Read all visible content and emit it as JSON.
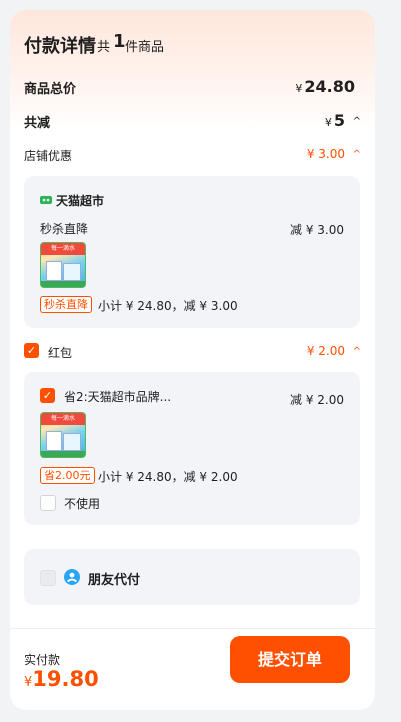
{
  "header": {
    "title": "付款详情",
    "sub_prefix": "共",
    "item_count": "1",
    "sub_suffix": "件商品"
  },
  "total_price": {
    "label": "商品总价",
    "currency": "¥",
    "amount": "24.80"
  },
  "total_reduce": {
    "label": "共减",
    "currency": "¥",
    "amount": "5"
  },
  "store_discount": {
    "label": "店铺优惠",
    "amount_text": "¥ 3.00",
    "card": {
      "store_name": "天猫超市",
      "promo_name": "秒杀直降",
      "promo_reduce": "减 ¥ 3.00",
      "thumb_text": "每一滴水",
      "tag": "秒杀直降",
      "subtotal_text": "小计 ¥ 24.80，减 ¥ 3.00"
    }
  },
  "red_packet": {
    "label": "红包",
    "amount_text": "¥ 2.00",
    "card": {
      "coupon_name": "省2:天猫超市品牌...",
      "coupon_reduce": "减 ¥ 2.00",
      "thumb_text": "每一滴水",
      "tag": "省2.00元",
      "subtotal_text": "小计 ¥ 24.80，减 ¥ 2.00",
      "no_use_label": "不使用"
    }
  },
  "friend_pay": {
    "label": "朋友代付"
  },
  "footer": {
    "actual_label": "实付款",
    "currency": "¥",
    "actual_amount": "19.80",
    "submit_label": "提交订单"
  },
  "colors": {
    "accent": "#ff5000",
    "card_bg": "#f2f4f7",
    "friend_icon": "#2aa4f4",
    "store_icon": "#2bb35a"
  }
}
